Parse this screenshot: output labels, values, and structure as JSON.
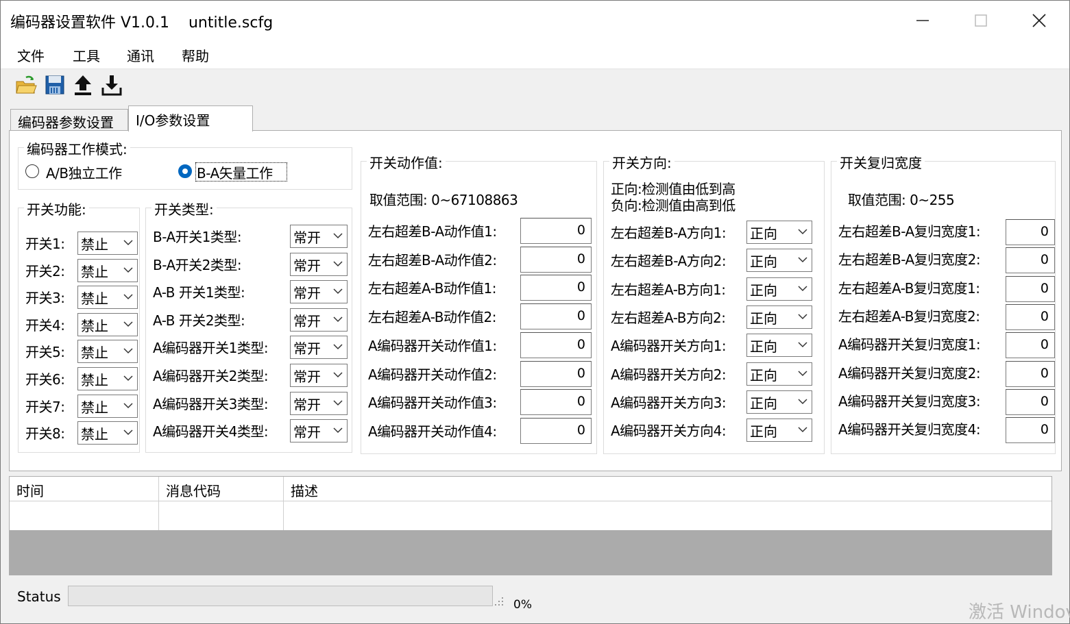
{
  "window": {
    "title": "编码器设置软件 V1.0.1    untitle.scfg"
  },
  "menu": [
    "文件",
    "工具",
    "通讯",
    "帮助"
  ],
  "toolbar": {
    "icons": [
      "open-folder-icon",
      "save-disk-icon",
      "upload-icon",
      "download-icon"
    ]
  },
  "tabs": [
    "编码器参数设置",
    "I/O参数设置"
  ],
  "mode_group": {
    "title": "编码器工作模式:",
    "options": [
      {
        "label": "A/B独立工作",
        "selected": false
      },
      {
        "label": "B-A矢量工作",
        "selected": true
      }
    ]
  },
  "switch_function": {
    "title": "开关功能:",
    "rows": [
      {
        "label": "开关1:",
        "value": "禁止"
      },
      {
        "label": "开关2:",
        "value": "禁止"
      },
      {
        "label": "开关3:",
        "value": "禁止"
      },
      {
        "label": "开关4:",
        "value": "禁止"
      },
      {
        "label": "开关5:",
        "value": "禁止"
      },
      {
        "label": "开关6:",
        "value": "禁止"
      },
      {
        "label": "开关7:",
        "value": "禁止"
      },
      {
        "label": "开关8:",
        "value": "禁止"
      }
    ]
  },
  "switch_type": {
    "title": "开关类型:",
    "rows": [
      {
        "label": "B-A开关1类型:",
        "value": "常开"
      },
      {
        "label": "B-A开关2类型:",
        "value": "常开"
      },
      {
        "label": "A-B 开关1类型:",
        "value": "常开"
      },
      {
        "label": "A-B 开关2类型:",
        "value": "常开"
      },
      {
        "label": "A编码器开关1类型:",
        "value": "常开"
      },
      {
        "label": "A编码器开关2类型:",
        "value": "常开"
      },
      {
        "label": "A编码器开关3类型:",
        "value": "常开"
      },
      {
        "label": "A编码器开关4类型:",
        "value": "常开"
      }
    ]
  },
  "action_value": {
    "title": "开关动作值:",
    "range": "取值范围: 0~67108863",
    "rows": [
      {
        "label": "左右超差B-A动作值1:",
        "value": "0"
      },
      {
        "label": "左右超差B-A动作值2:",
        "value": "0"
      },
      {
        "label": "左右超差A-B动作值1:",
        "value": "0"
      },
      {
        "label": "左右超差A-B动作值2:",
        "value": "0"
      },
      {
        "label": "A编码器开关动作值1:",
        "value": "0"
      },
      {
        "label": "A编码器开关动作值2:",
        "value": "0"
      },
      {
        "label": "A编码器开关动作值3:",
        "value": "0"
      },
      {
        "label": "A编码器开关动作值4:",
        "value": "0"
      }
    ]
  },
  "direction": {
    "title": "开关方向:",
    "note1": "正向:检测值由低到高",
    "note2": "负向:检测值由高到低",
    "rows": [
      {
        "label": "左右超差B-A方向1:",
        "value": "正向"
      },
      {
        "label": "左右超差B-A方向2:",
        "value": "正向"
      },
      {
        "label": "左右超差A-B方向1:",
        "value": "正向"
      },
      {
        "label": "左右超差A-B方向2:",
        "value": "正向"
      },
      {
        "label": "A编码器开关方向1:",
        "value": "正向"
      },
      {
        "label": "A编码器开关方向2:",
        "value": "正向"
      },
      {
        "label": "A编码器开关方向3:",
        "value": "正向"
      },
      {
        "label": "A编码器开关方向4:",
        "value": "正向"
      }
    ]
  },
  "reset_width": {
    "title": "开关复归宽度",
    "range": "取值范围: 0~255",
    "rows": [
      {
        "label": "左右超差B-A复归宽度1:",
        "value": "0"
      },
      {
        "label": "左右超差B-A复归宽度2:",
        "value": "0"
      },
      {
        "label": "左右超差A-B复归宽度1:",
        "value": "0"
      },
      {
        "label": "左右超差A-B复归宽度2:",
        "value": "0"
      },
      {
        "label": "A编码器开关复归宽度1:",
        "value": "0"
      },
      {
        "label": "A编码器开关复归宽度2:",
        "value": "0"
      },
      {
        "label": "A编码器开关复归宽度3:",
        "value": "0"
      },
      {
        "label": "A编码器开关复归宽度4:",
        "value": "0"
      }
    ]
  },
  "log_table": {
    "columns": [
      "时间",
      "消息代码",
      "描述"
    ]
  },
  "status": {
    "label": "Status",
    "progress_fraction": 0,
    "percent_text": "0%"
  },
  "watermark": "激活 Windov"
}
